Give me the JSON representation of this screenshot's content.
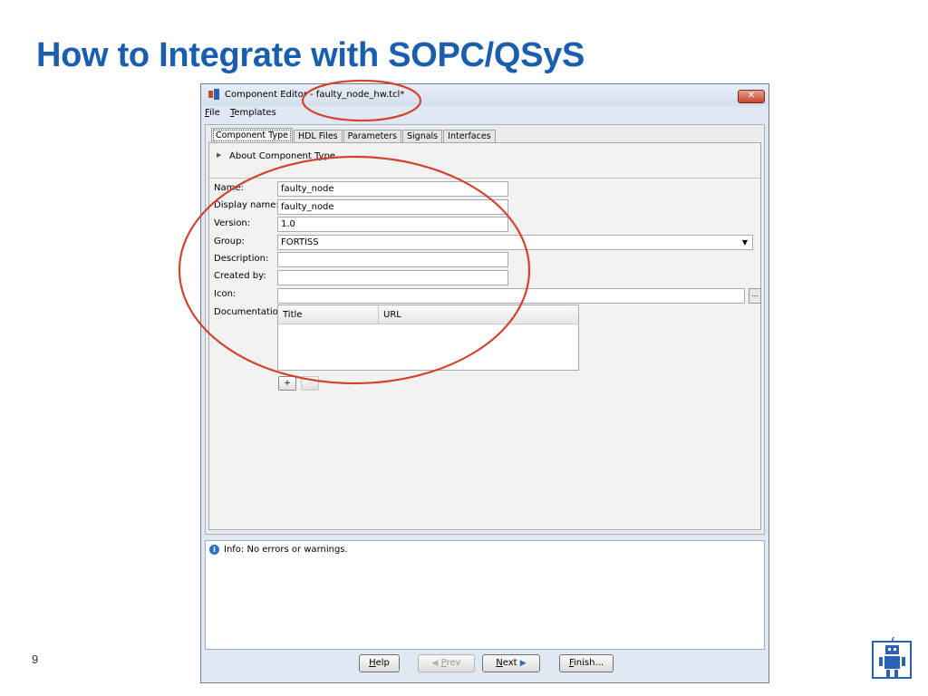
{
  "slide": {
    "title": "How to Integrate with SOPC/QSyS",
    "page_number": "9"
  },
  "window": {
    "title": "Component Editor - faulty_node_hw.tcl*",
    "close_symbol": "✕",
    "menu": [
      {
        "label": "File",
        "mnemonic": "F",
        "rest": "ile"
      },
      {
        "label": "Templates",
        "mnemonic": "T",
        "rest": "emplates"
      }
    ]
  },
  "tabs": [
    "Component Type",
    "HDL Files",
    "Parameters",
    "Signals",
    "Interfaces"
  ],
  "about": {
    "label": "About Component Type"
  },
  "form": {
    "name": {
      "label": "Name:",
      "value": "faulty_node"
    },
    "display_name": {
      "label": "Display name:",
      "value": "faulty_node"
    },
    "version": {
      "label": "Version:",
      "value": "1.0"
    },
    "group": {
      "label": "Group:",
      "value": "FORTISS"
    },
    "description": {
      "label": "Description:",
      "value": ""
    },
    "created_by": {
      "label": "Created by:",
      "value": ""
    },
    "icon": {
      "label": "Icon:",
      "value": "",
      "browse_label": "..."
    },
    "documentation": {
      "label": "Documentation:",
      "columns": [
        "Title",
        "URL"
      ]
    },
    "add_label": "+",
    "remove_label": "-"
  },
  "messages": {
    "info": "Info: No errors or warnings."
  },
  "footer": {
    "help": {
      "mnemonic": "H",
      "rest": "elp"
    },
    "prev": {
      "mnemonic": "P",
      "rest": "rev"
    },
    "next": {
      "mnemonic": "N",
      "rest": "ext"
    },
    "finish": {
      "mnemonic": "F",
      "rest": "inish..."
    }
  },
  "icons": {
    "app": "component-editor-app-icon",
    "info": "info-icon",
    "logo": "robot-logo-icon"
  },
  "colors": {
    "title": "#1a5fad",
    "annotation": "#d2432e",
    "info": "#2f6fc4"
  }
}
